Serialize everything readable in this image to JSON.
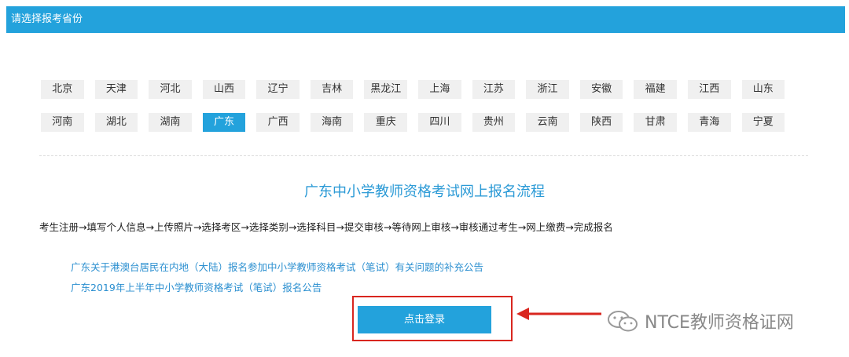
{
  "header": {
    "title": "请选择报考省份"
  },
  "provinces": {
    "row1": [
      "北京",
      "天津",
      "河北",
      "山西",
      "辽宁",
      "吉林",
      "黑龙江",
      "上海",
      "江苏",
      "浙江",
      "安徽",
      "福建",
      "江西",
      "山东"
    ],
    "row2": [
      "河南",
      "湖北",
      "湖南",
      "广东",
      "广西",
      "海南",
      "重庆",
      "四川",
      "贵州",
      "云南",
      "陕西",
      "甘肃",
      "青海",
      "宁夏"
    ],
    "selected": "广东"
  },
  "flow": {
    "title": "广东中小学教师资格考试网上报名流程",
    "steps": "考生注册→填写个人信息→上传照片→选择考区→选择类别→选择科目→提交审核→等待网上审核→审核通过考生→网上缴费→完成报名"
  },
  "notices": [
    "广东关于港澳台居民在内地（大陆）报名参加中小学教师资格考试（笔试）有关问题的补充公告",
    "广东2019年上半年中小学教师资格考试（笔试）报名公告"
  ],
  "login": {
    "label": "点击登录"
  },
  "annotation": {
    "color": "#d9261f"
  },
  "watermark": {
    "text": "NTCE教师资格证网",
    "icon": "wechat-icon"
  },
  "colors": {
    "accent": "#23a2dc",
    "link": "#2b8fd0"
  }
}
